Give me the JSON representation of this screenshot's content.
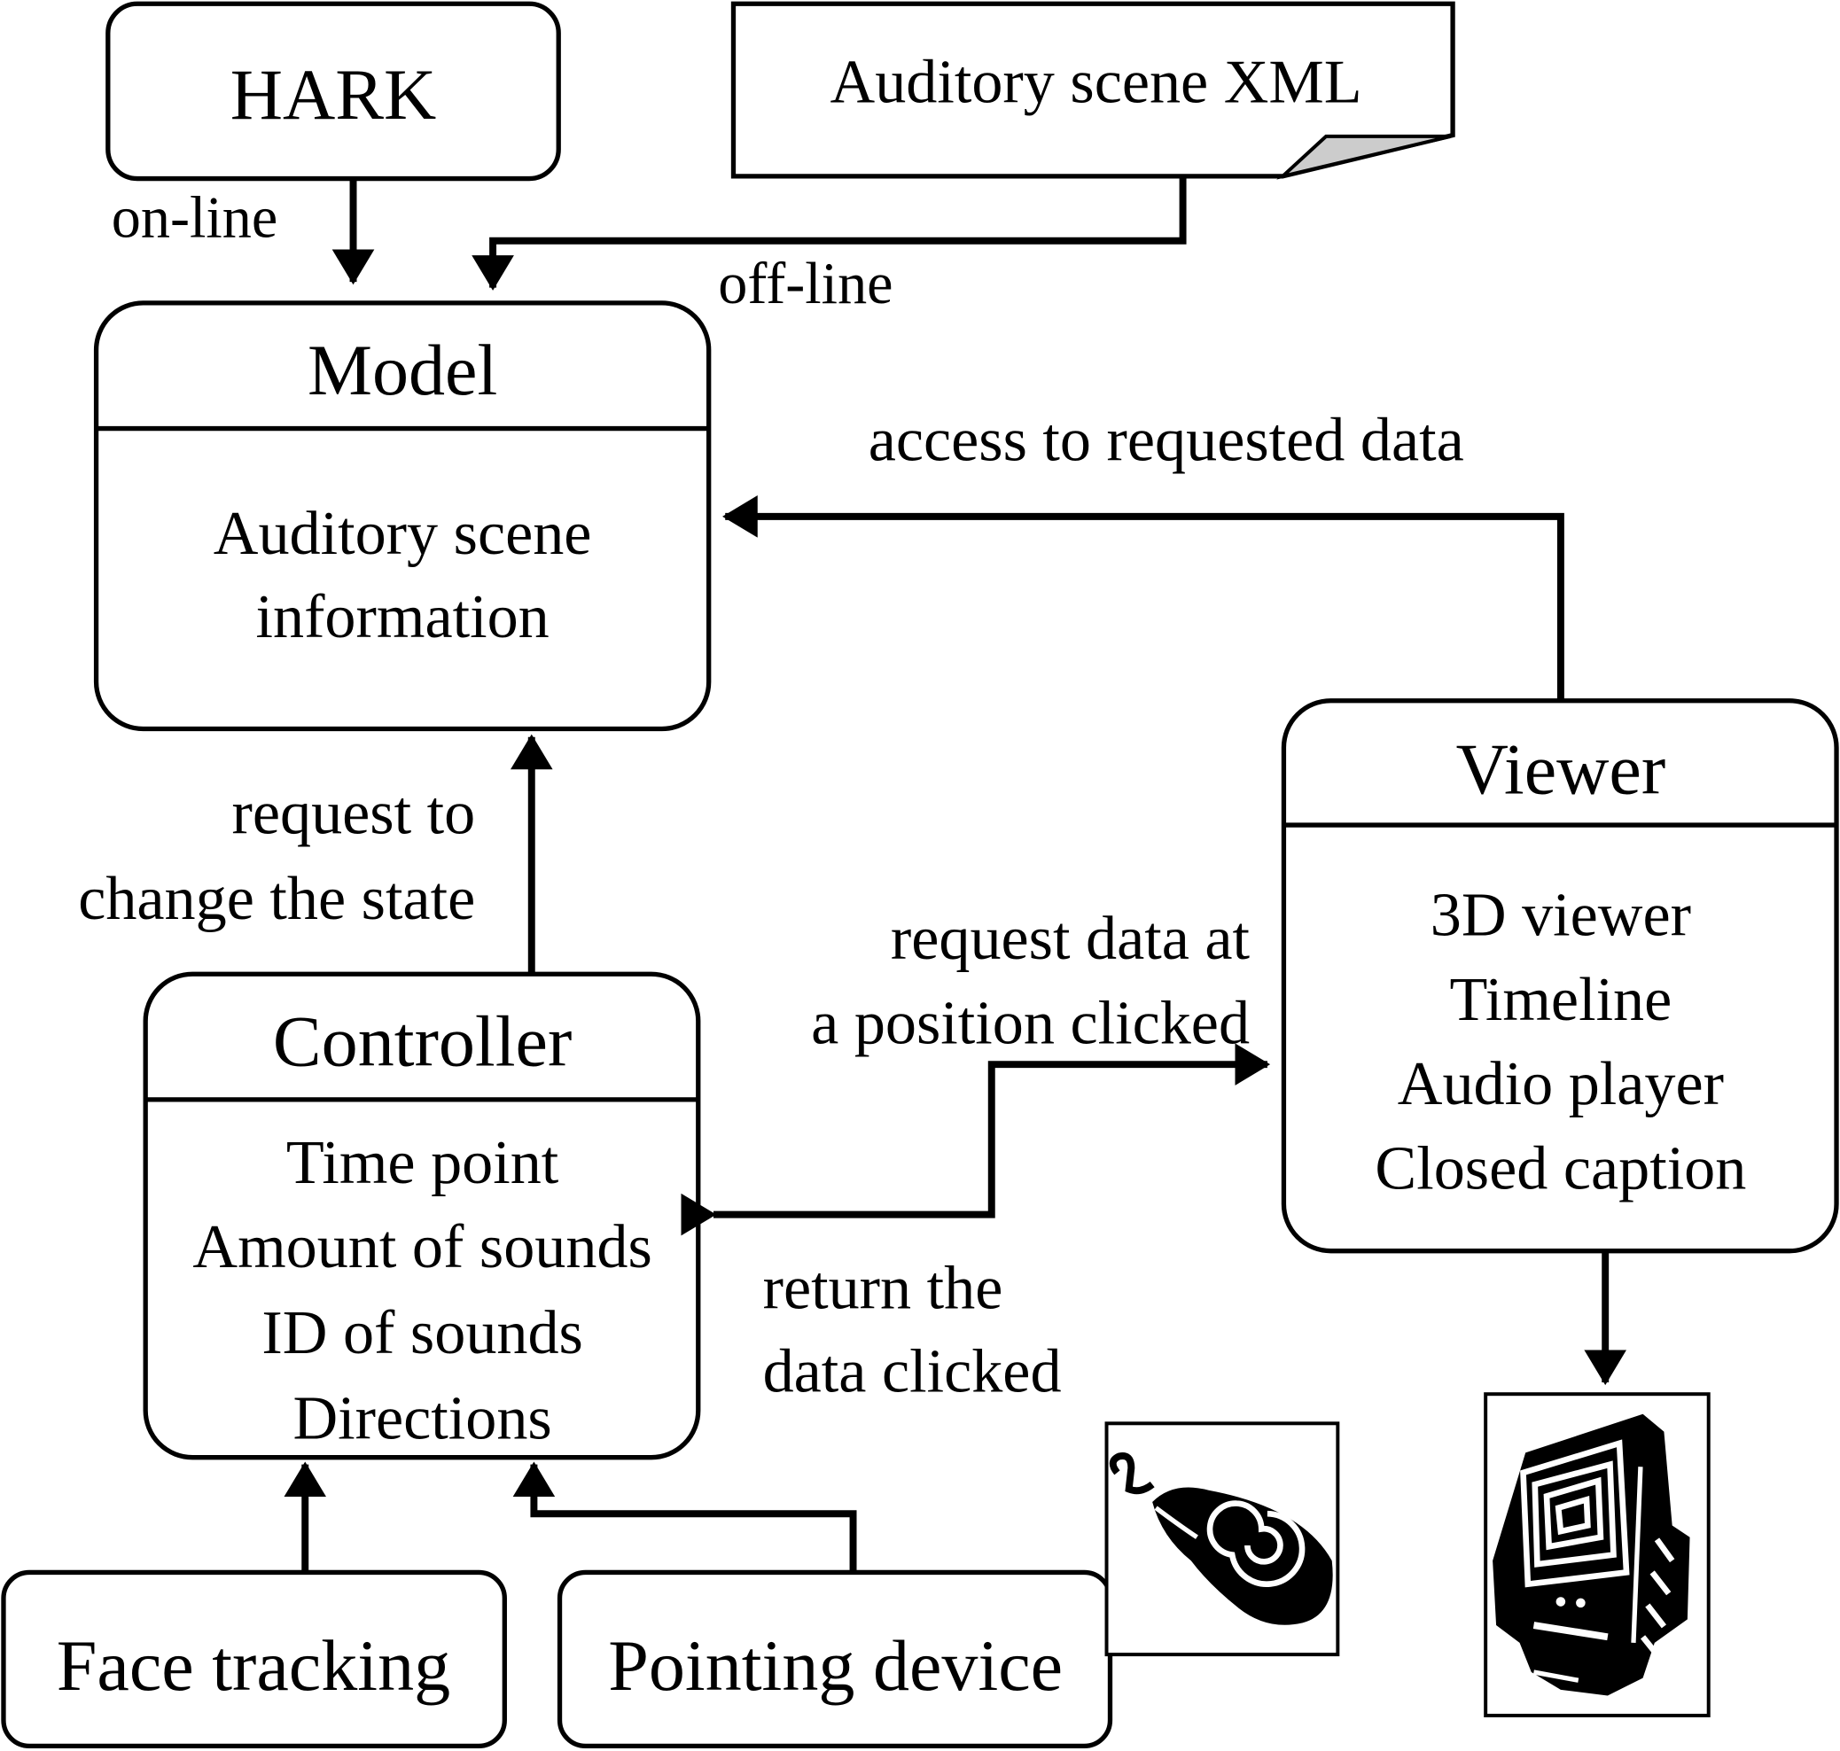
{
  "nodes": {
    "hark": {
      "title": "HARK"
    },
    "xml": {
      "title": "Auditory scene XML"
    },
    "model": {
      "title": "Model",
      "body": [
        "Auditory scene",
        "information"
      ]
    },
    "viewer": {
      "title": "Viewer",
      "body": [
        "3D viewer",
        "Timeline",
        "Audio player",
        "Closed caption"
      ]
    },
    "controller": {
      "title": "Controller",
      "body": [
        "Time point",
        "Amount of sounds",
        "ID of sounds",
        "Directions"
      ]
    },
    "face": {
      "title": "Face tracking"
    },
    "pointing": {
      "title": "Pointing device"
    }
  },
  "edges": {
    "online": "on-line",
    "offline": "off-line",
    "access": "access to requested data",
    "change_state": [
      "request to",
      "change the state"
    ],
    "request_data": [
      "request data at",
      "a position clicked"
    ],
    "return_data": [
      "return the",
      "data clicked"
    ]
  },
  "icons": {
    "mouse": "computer-mouse-icon",
    "monitor": "computer-monitor-icon",
    "fold_color": "#cccccc"
  }
}
